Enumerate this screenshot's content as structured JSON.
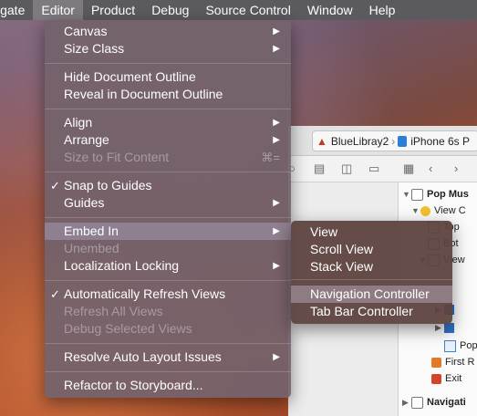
{
  "menubar": {
    "items": [
      "vigate",
      "Editor",
      "Product",
      "Debug",
      "Source Control",
      "Window",
      "Help"
    ]
  },
  "xcode": {
    "scheme": "BlueLibray2",
    "device": "iPhone 6s P",
    "outline": {
      "rows": [
        "Pop Mus",
        "View C",
        "Top",
        "Bot",
        "View",
        "Pop",
        "First R",
        "Exit",
        "Navigati"
      ]
    }
  },
  "editor_menu": {
    "canvas": "Canvas",
    "size_class": "Size Class",
    "hide_outline": "Hide Document Outline",
    "reveal_outline": "Reveal in Document Outline",
    "align": "Align",
    "arrange": "Arrange",
    "size_to_fit": "Size to Fit Content",
    "size_to_fit_shortcut": "⌘=",
    "snap_to_guides": "Snap to Guides",
    "guides": "Guides",
    "embed_in": "Embed In",
    "unembed": "Unembed",
    "localization_locking": "Localization Locking",
    "auto_refresh": "Automatically Refresh Views",
    "refresh_all": "Refresh All Views",
    "debug_selected": "Debug Selected Views",
    "resolve_auto_layout": "Resolve Auto Layout Issues",
    "refactor": "Refactor to Storyboard..."
  },
  "embed_submenu": {
    "view": "View",
    "scroll_view": "Scroll View",
    "stack_view": "Stack View",
    "navigation_controller": "Navigation Controller",
    "tab_bar_controller": "Tab Bar Controller"
  },
  "icons": {
    "check": "✓",
    "arrow": "▶"
  }
}
